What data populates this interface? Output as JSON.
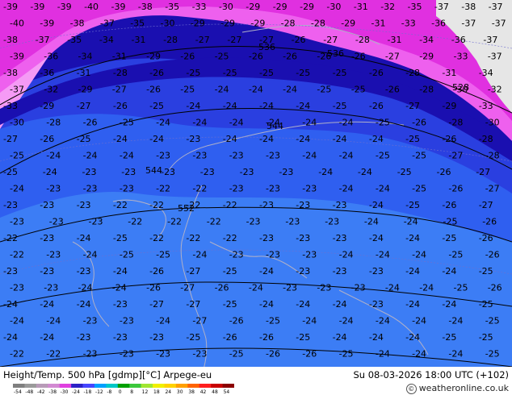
{
  "header": {
    "title": "Height/Temp. 500 hPa [gdmp][°C] Arpege-eu",
    "valid_time": "Su 08-03-2026 18:00 UTC (+102)",
    "credit": "© weatheronline.co.uk"
  },
  "legend": {
    "ticks": [
      "-54",
      "-48",
      "-42",
      "-38",
      "-30",
      "-24",
      "-18",
      "-12",
      "-8",
      "0",
      "8",
      "12",
      "18",
      "24",
      "30",
      "38",
      "42",
      "48",
      "54"
    ],
    "colors": [
      "#7f7f7f",
      "#9a9a9a",
      "#b89bb8",
      "#d28ad2",
      "#e040e0",
      "#2c22c6",
      "#4646ff",
      "#00a0ff",
      "#00c8c8",
      "#00a000",
      "#3cc83c",
      "#a0e632",
      "#f0f000",
      "#ffd200",
      "#ffa000",
      "#ff6400",
      "#ff1e1e",
      "#c80000",
      "#8c0000"
    ]
  },
  "map": {
    "colors": {
      "deep_magenta": "#e030e0",
      "magenta": "#ee60ee",
      "light_magenta": "#f59af5",
      "dark_blue": "#1a0fb0",
      "blue": "#2a3fe0",
      "mid_blue": "#2f5ff0",
      "light_blue": "#3c7df5",
      "land_grey": "#e6e6e6",
      "label_color": "#000000",
      "contour_color": "#000000",
      "coast_color": "#b0b0c8"
    },
    "labels_row_y_values": [
      {
        "row": 1,
        "values": [
          "-39",
          "-39",
          "-39",
          "-40",
          "-39",
          "-38",
          "-35",
          "-33",
          "-30",
          "-29",
          "-29",
          "-29",
          "-30",
          "-31",
          "-32",
          "-35",
          "-37",
          "-38",
          "-37"
        ]
      },
      {
        "row": 2,
        "values": [
          "-40",
          "-39",
          "-38",
          "-37",
          "-35",
          "-30",
          "-29",
          "-29",
          "-29",
          "-28",
          "-28",
          "-29",
          "-31",
          "-33",
          "-36",
          "-37",
          "-37"
        ]
      },
      {
        "row": 3,
        "values": [
          "-38",
          "-37",
          "-35",
          "-34",
          "-31",
          "-28",
          "-27",
          "-27",
          "-27",
          "-26",
          "-27",
          "-28",
          "-31",
          "-34",
          "-36",
          "-37"
        ]
      },
      {
        "row": 4,
        "values": [
          "-39",
          "-36",
          "-34",
          "-31",
          "-29",
          "-26",
          "-25",
          "-26",
          "-26",
          "-26",
          "-26",
          "-27",
          "-29",
          "-33",
          "-37"
        ]
      },
      {
        "row": 5,
        "values": [
          "-38",
          "-36",
          "-31",
          "-28",
          "-26",
          "-25",
          "-25",
          "-25",
          "-25",
          "-25",
          "-26",
          "-28",
          "-31",
          "-34"
        ]
      },
      {
        "row": 6,
        "values": [
          "-37",
          "-32",
          "-29",
          "-27",
          "-26",
          "-25",
          "-24",
          "-24",
          "-24",
          "-25",
          "-25",
          "-26",
          "-28",
          "-30",
          "-32"
        ]
      },
      {
        "row": 7,
        "values": [
          "-33",
          "-29",
          "-27",
          "-26",
          "-25",
          "-24",
          "-24",
          "-24",
          "-24",
          "-25",
          "-26",
          "-27",
          "-29",
          "-33"
        ]
      },
      {
        "row": 8,
        "values": [
          "-30",
          "-28",
          "-26",
          "-25",
          "-24",
          "-24",
          "-24",
          "-24",
          "-24",
          "-24",
          "-25",
          "-26",
          "-28",
          "-30"
        ]
      },
      {
        "row": 9,
        "values": [
          "-27",
          "-26",
          "-25",
          "-24",
          "-24",
          "-23",
          "-24",
          "-24",
          "-24",
          "-24",
          "-24",
          "-25",
          "-26",
          "-28"
        ]
      },
      {
        "row": 10,
        "values": [
          "-25",
          "-24",
          "-24",
          "-24",
          "-23",
          "-23",
          "-23",
          "-23",
          "-24",
          "-24",
          "-25",
          "-25",
          "-27",
          "-28"
        ]
      },
      {
        "row": 11,
        "values": [
          "-25",
          "-24",
          "-23",
          "-23",
          "-23",
          "-23",
          "-23",
          "-23",
          "-24",
          "-24",
          "-25",
          "-26",
          "-27"
        ]
      },
      {
        "row": 12,
        "values": [
          "-24",
          "-23",
          "-23",
          "-23",
          "-22",
          "-22",
          "-23",
          "-23",
          "-23",
          "-24",
          "-24",
          "-25",
          "-26",
          "-27"
        ]
      },
      {
        "row": 13,
        "values": [
          "-23",
          "-23",
          "-23",
          "-22",
          "-22",
          "-22",
          "-22",
          "-23",
          "-23",
          "-23",
          "-24",
          "-25",
          "-26",
          "-27"
        ]
      },
      {
        "row": 14,
        "values": [
          "-23",
          "-23",
          "-23",
          "-22",
          "-22",
          "-22",
          "-23",
          "-23",
          "-23",
          "-24",
          "-24",
          "-25",
          "-26"
        ]
      },
      {
        "row": 15,
        "values": [
          "-22",
          "-23",
          "-24",
          "-25",
          "-22",
          "-22",
          "-22",
          "-23",
          "-23",
          "-23",
          "-24",
          "-24",
          "-25",
          "-26"
        ]
      },
      {
        "row": 16,
        "values": [
          "-22",
          "-23",
          "-24",
          "-25",
          "-25",
          "-24",
          "-23",
          "-23",
          "-23",
          "-24",
          "-24",
          "-24",
          "-25",
          "-26"
        ]
      },
      {
        "row": 17,
        "values": [
          "-23",
          "-23",
          "-23",
          "-24",
          "-26",
          "-27",
          "-25",
          "-24",
          "-23",
          "-23",
          "-23",
          "-24",
          "-24",
          "-25"
        ]
      },
      {
        "row": 18,
        "values": [
          "-23",
          "-23",
          "-24",
          "-24",
          "-26",
          "-27",
          "-26",
          "-24",
          "-23",
          "-23",
          "-23",
          "-24",
          "-24",
          "-25",
          "-26"
        ]
      },
      {
        "row": 19,
        "values": [
          "-24",
          "-24",
          "-24",
          "-23",
          "-27",
          "-27",
          "-25",
          "-24",
          "-24",
          "-24",
          "-23",
          "-24",
          "-24",
          "-25"
        ]
      },
      {
        "row": 20,
        "values": [
          "-24",
          "-24",
          "-23",
          "-23",
          "-24",
          "-27",
          "-26",
          "-25",
          "-24",
          "-24",
          "-24",
          "-24",
          "-24",
          "-25"
        ]
      },
      {
        "row": 21,
        "values": [
          "-24",
          "-24",
          "-23",
          "-23",
          "-23",
          "-25",
          "-26",
          "-26",
          "-25",
          "-24",
          "-24",
          "-24",
          "-25",
          "-25"
        ]
      },
      {
        "row": 22,
        "values": [
          "-22",
          "-22",
          "-23",
          "-23",
          "-23",
          "-23",
          "-25",
          "-26",
          "-26",
          "-25",
          "-24",
          "-24",
          "-24",
          "-25"
        ]
      }
    ],
    "contour_labels": [
      "536",
      "544",
      "552",
      "544",
      "536",
      "528"
    ]
  }
}
